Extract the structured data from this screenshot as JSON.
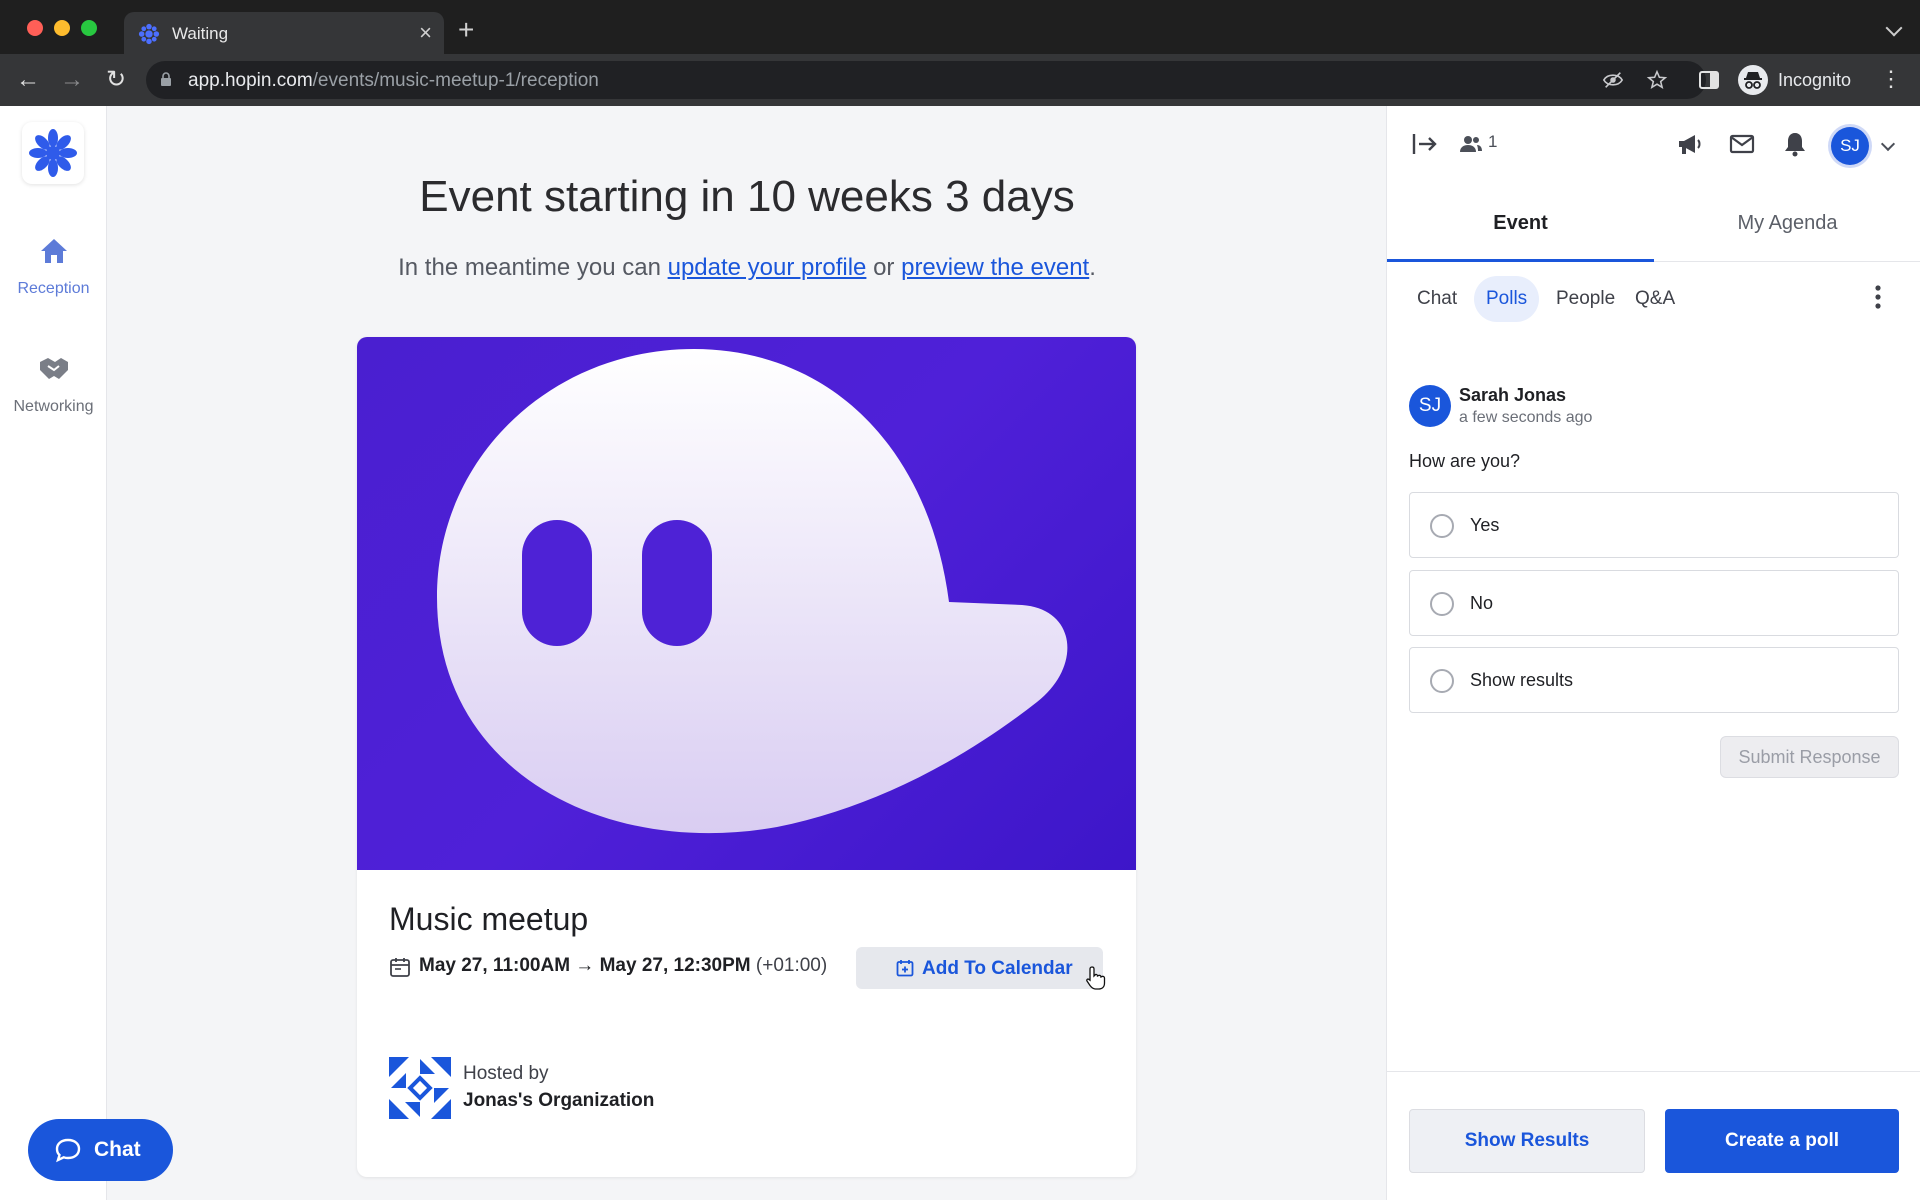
{
  "browser": {
    "tab_title": "Waiting",
    "url_host": "app.hopin.com",
    "url_path": "/events/music-meetup-1/reception",
    "profile_label": "Incognito"
  },
  "leftnav": {
    "items": [
      {
        "label": "Reception",
        "icon": "home-icon",
        "active": true
      },
      {
        "label": "Networking",
        "icon": "handshake-icon",
        "active": false
      }
    ],
    "chat_button": "Chat"
  },
  "main": {
    "headline": "Event starting in 10 weeks 3 days",
    "sub_prefix": "In the meantime you can ",
    "sub_link1": "update your profile",
    "sub_middle": " or ",
    "sub_link2": "preview the event",
    "sub_suffix": ".",
    "event": {
      "name": "Music meetup",
      "date_range": "May 27, 11:00AM → May 27, 12:30PM",
      "timezone": "(+01:00)",
      "add_to_calendar": "Add To Calendar",
      "hosted_by_label": "Hosted by",
      "host_name": "Jonas's Organization"
    }
  },
  "panel": {
    "attendee_count": "1",
    "user_initials": "SJ",
    "tabs": [
      "Event",
      "My Agenda"
    ],
    "active_tab": "Event",
    "subtabs": [
      "Chat",
      "Polls",
      "People",
      "Q&A"
    ],
    "active_subtab": "Polls",
    "poll": {
      "author_initials": "SJ",
      "author": "Sarah Jonas",
      "time": "a few seconds ago",
      "question": "How are you?",
      "options": [
        "Yes",
        "No",
        "Show results"
      ],
      "submit_label": "Submit Response"
    },
    "footer": {
      "show_results": "Show Results",
      "create_poll": "Create a poll"
    }
  },
  "colors": {
    "brand": "#1a56db",
    "banner": "#4a1fd0"
  }
}
